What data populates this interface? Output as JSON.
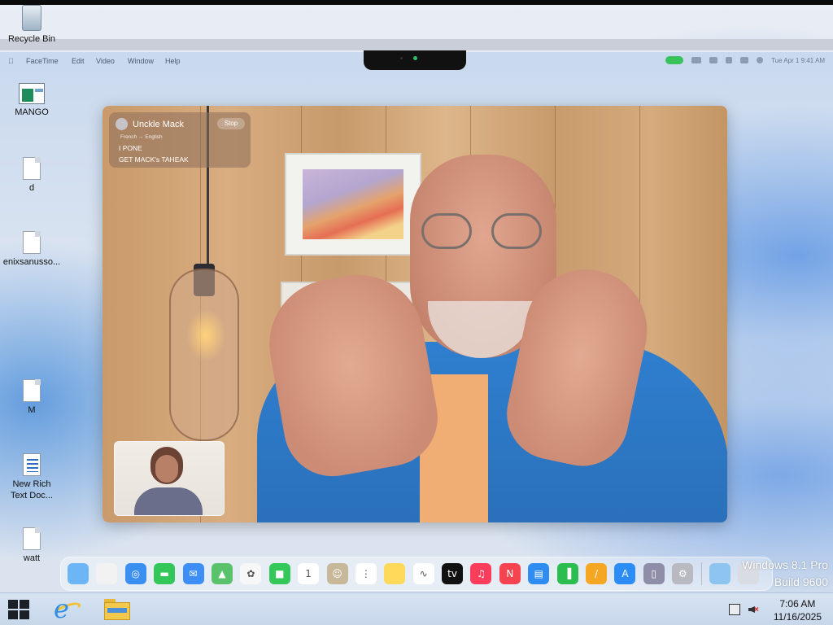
{
  "desktop": {
    "icons": [
      {
        "label": "Recycle Bin"
      },
      {
        "label": "MANGO"
      },
      {
        "label": "d"
      },
      {
        "label": "enixsanusso..."
      },
      {
        "label": "M"
      },
      {
        "label": "New Rich Text Doc..."
      },
      {
        "label": "watt"
      }
    ]
  },
  "mac": {
    "menubar": {
      "apple": "",
      "items": [
        "FaceTime",
        "Edit",
        "Video",
        "Window",
        "Help"
      ],
      "clock_text": "Tue Apr 1  9:41 AM"
    },
    "caption": {
      "name": "Unckle Mack",
      "stop_label": "Stop",
      "languages": "French → English",
      "line1": "I PONE",
      "line2": "GET MACK's TAHEAK"
    },
    "dock_icons": [
      {
        "name": "finder-icon",
        "color": "#6db6f5",
        "glyph": ""
      },
      {
        "name": "launchpad-icon",
        "color": "#f2f2f2",
        "glyph": ""
      },
      {
        "name": "safari-icon",
        "color": "#3b8ff0",
        "glyph": "◎"
      },
      {
        "name": "messages-icon",
        "color": "#33c759",
        "glyph": "▬"
      },
      {
        "name": "mail-icon",
        "color": "#3d8ef7",
        "glyph": "✉"
      },
      {
        "name": "maps-icon",
        "color": "#59c26b",
        "glyph": "▲"
      },
      {
        "name": "photos-icon",
        "color": "#f7f7f7",
        "glyph": "✿"
      },
      {
        "name": "facetime-icon",
        "color": "#34c759",
        "glyph": "■"
      },
      {
        "name": "calendar-icon",
        "color": "#ffffff",
        "glyph": "1"
      },
      {
        "name": "contacts-icon",
        "color": "#c7b89a",
        "glyph": "☺"
      },
      {
        "name": "reminders-icon",
        "color": "#ffffff",
        "glyph": "⋮"
      },
      {
        "name": "notes-icon",
        "color": "#ffd95a",
        "glyph": ""
      },
      {
        "name": "freeform-icon",
        "color": "#ffffff",
        "glyph": "∿"
      },
      {
        "name": "apple-tv-icon",
        "color": "#111111",
        "glyph": "tv"
      },
      {
        "name": "music-icon",
        "color": "#fa3d5b",
        "glyph": "♫"
      },
      {
        "name": "news-icon",
        "color": "#f5444f",
        "glyph": "N"
      },
      {
        "name": "keynote-icon",
        "color": "#2f8cf0",
        "glyph": "▤"
      },
      {
        "name": "numbers-icon",
        "color": "#2bbd4e",
        "glyph": "▐"
      },
      {
        "name": "pages-icon",
        "color": "#f5a623",
        "glyph": "/"
      },
      {
        "name": "app-store-icon",
        "color": "#2b8df5",
        "glyph": "A"
      },
      {
        "name": "iphone-mirroring-icon",
        "color": "#8e8ea8",
        "glyph": "▯"
      },
      {
        "name": "system-settings-icon",
        "color": "#b9b9c2",
        "glyph": "⚙"
      },
      {
        "name": "downloads-folder-icon",
        "color": "#8ec5f0",
        "glyph": ""
      },
      {
        "name": "trash-icon",
        "color": "#d9dde3",
        "glyph": ""
      }
    ]
  },
  "watermark": {
    "line1": "Windows 8.1 Pro",
    "line2": "Build 9600"
  },
  "taskbar": {
    "time": "7:06 AM",
    "date": "11/16/2025"
  }
}
